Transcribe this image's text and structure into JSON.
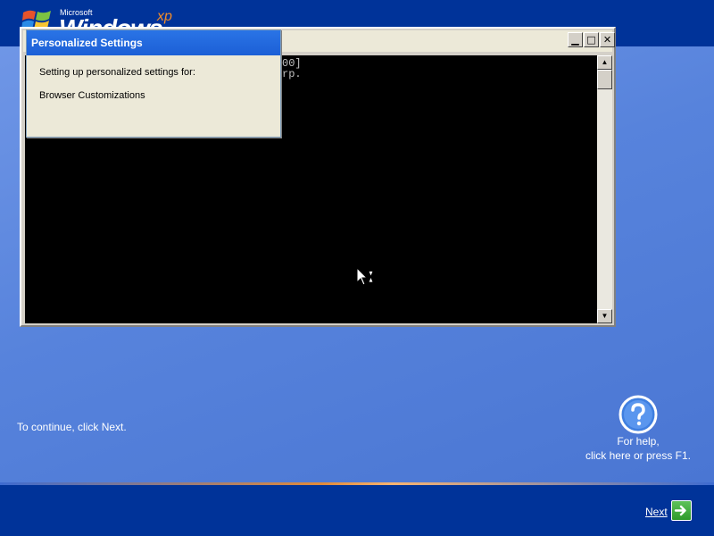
{
  "logo": {
    "microsoft": "Microsoft",
    "windows": "Windows",
    "xp": "xp"
  },
  "console": {
    "line1": "00]",
    "line2": "rp.",
    "minimize_icon": "minimize-icon",
    "maximize_icon": "maximize-icon",
    "close_icon": "close-icon"
  },
  "personalized_settings": {
    "title": "Personalized Settings",
    "line1": "Setting up personalized settings for:",
    "line2": "Browser Customizations"
  },
  "footer": {
    "continue_text": "To continue, click Next.",
    "help_line1": "For help,",
    "help_line2": "click here or press F1.",
    "next_label": "Next"
  },
  "colors": {
    "top_band": "#003399",
    "bottom_band": "#003399",
    "accent_orange": "#f28c28",
    "titlebar_blue": "#1c5fd6"
  }
}
